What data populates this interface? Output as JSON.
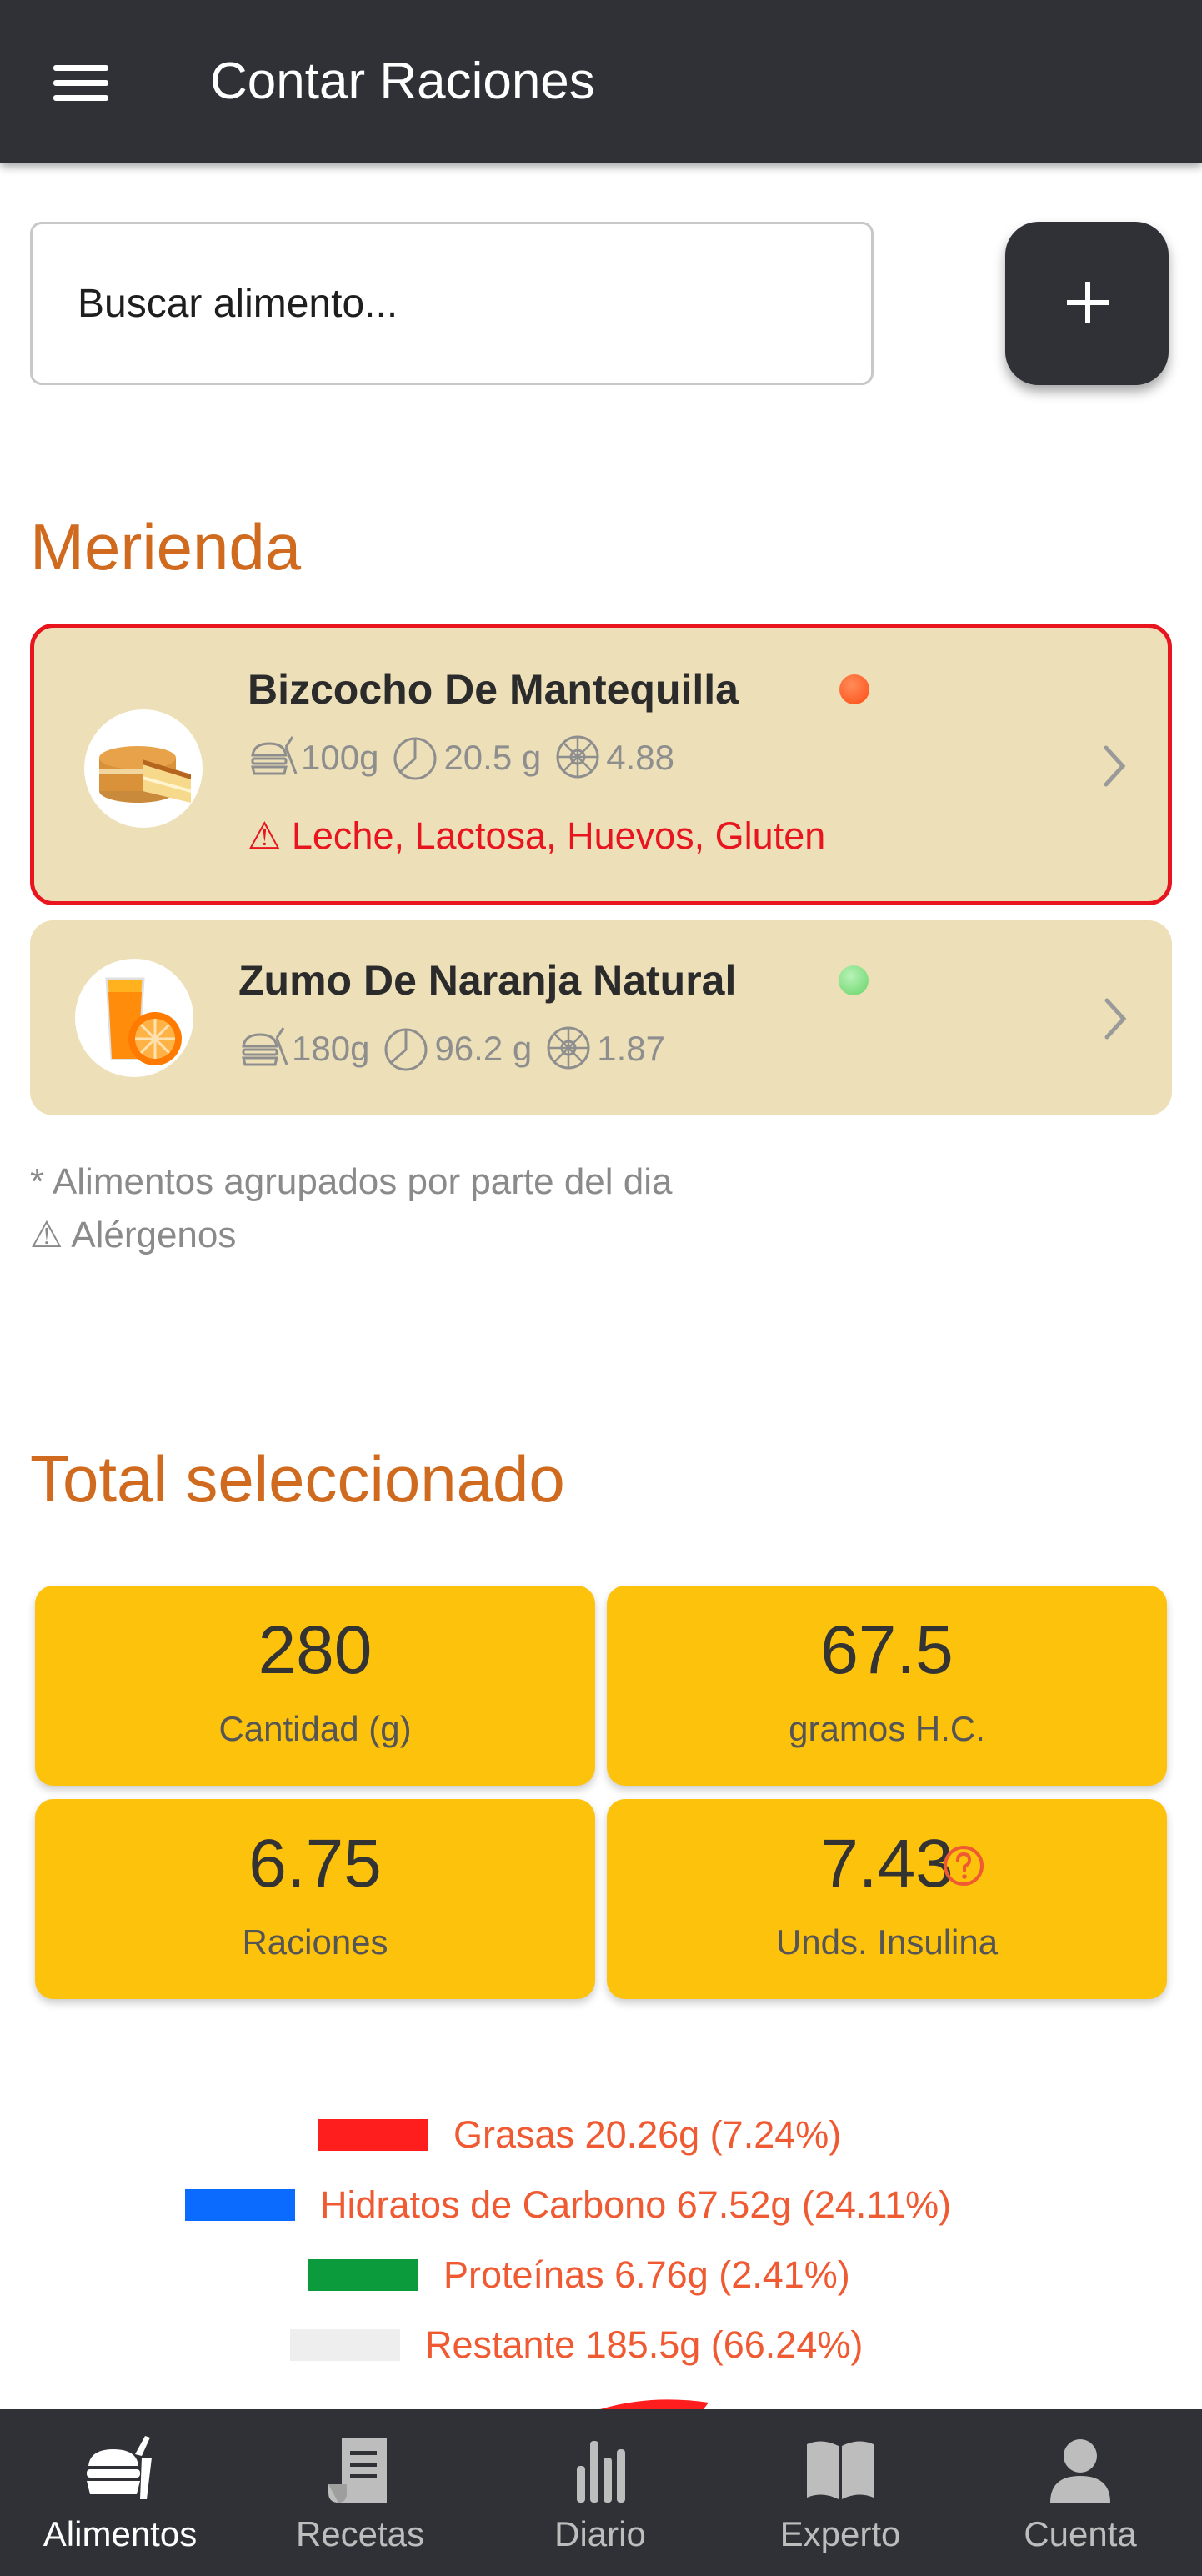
{
  "header": {
    "title": "Contar Raciones"
  },
  "search": {
    "placeholder": "Buscar alimento..."
  },
  "meal_section": {
    "title": "Merienda"
  },
  "foods": [
    {
      "name": "Bizcocho De Mantequilla",
      "status_color": "#ff5a1e",
      "weight": "100g",
      "carbs": "20.5 g",
      "rations": "4.88",
      "allergens": "Leche, Lactosa, Huevos, Gluten",
      "allergen_icon": "⚠",
      "image_icon": "cake-icon"
    },
    {
      "name": "Zumo De Naranja Natural",
      "status_color": "#7ee07e",
      "weight": "180g",
      "carbs": "96.2 g",
      "rations": "1.87",
      "image_icon": "orange-juice-icon"
    }
  ],
  "notes": {
    "grouped": "* Alimentos agrupados por parte del dia",
    "allergens": "⚠ Alérgenos"
  },
  "totals_section": {
    "title": "Total seleccionado"
  },
  "totals": [
    {
      "value": "280",
      "label": "Cantidad (g)"
    },
    {
      "value": "67.5",
      "label": "gramos H.C."
    },
    {
      "value": "6.75",
      "label": "Raciones"
    },
    {
      "value": "7.43",
      "label": "Unds. Insulina"
    }
  ],
  "legend": [
    {
      "label": "Grasas 20.26g (7.24%)",
      "color": "#ff1e1e"
    },
    {
      "label": "Hidratos de Carbono 67.52g (24.11%)",
      "color": "#0b6bff"
    },
    {
      "label": "Proteínas 6.76g (2.41%)",
      "color": "#0b9a3c"
    },
    {
      "label": "Restante 185.5g (66.24%)",
      "color": "#eeeeee"
    }
  ],
  "bottom_nav": [
    {
      "label": "Alimentos",
      "icon": "food-icon",
      "active": true
    },
    {
      "label": "Recetas",
      "icon": "recipe-icon",
      "active": false
    },
    {
      "label": "Diario",
      "icon": "chart-bars-icon",
      "active": false
    },
    {
      "label": "Experto",
      "icon": "book-icon",
      "active": false
    },
    {
      "label": "Cuenta",
      "icon": "user-icon",
      "active": false
    }
  ]
}
